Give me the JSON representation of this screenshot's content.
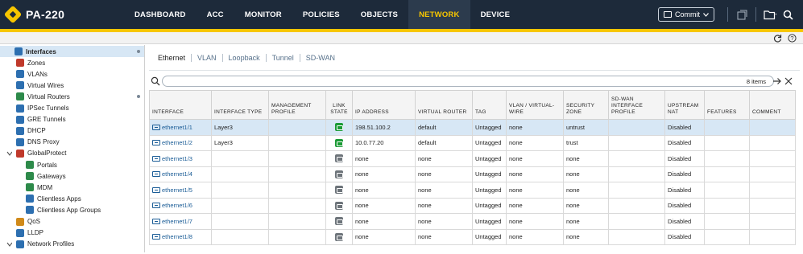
{
  "app": {
    "title": "PA-220"
  },
  "nav": [
    "DASHBOARD",
    "ACC",
    "MONITOR",
    "POLICIES",
    "OBJECTS",
    "NETWORK",
    "DEVICE"
  ],
  "active_nav": "NETWORK",
  "commit_label": "Commit",
  "sidebar": [
    {
      "label": "Interfaces",
      "icon": "interfaces-icon",
      "color": "#2d6fb0",
      "active": true,
      "dot": true
    },
    {
      "label": "Zones",
      "icon": "zones-icon",
      "color": "#c0392b"
    },
    {
      "label": "VLANs",
      "icon": "vlans-icon",
      "color": "#2d6fb0"
    },
    {
      "label": "Virtual Wires",
      "icon": "virtual-wires-icon",
      "color": "#2d6fb0"
    },
    {
      "label": "Virtual Routers",
      "icon": "virtual-routers-icon",
      "color": "#2d8a4a",
      "dot": true
    },
    {
      "label": "IPSec Tunnels",
      "icon": "ipsec-tunnels-icon",
      "color": "#2d6fb0"
    },
    {
      "label": "GRE Tunnels",
      "icon": "gre-tunnels-icon",
      "color": "#2d6fb0"
    },
    {
      "label": "DHCP",
      "icon": "dhcp-icon",
      "color": "#2d6fb0"
    },
    {
      "label": "DNS Proxy",
      "icon": "dns-proxy-icon",
      "color": "#2d6fb0"
    },
    {
      "label": "GlobalProtect",
      "icon": "globalprotect-icon",
      "color": "#c0392b"
    },
    {
      "label": "Portals",
      "icon": "portals-icon",
      "color": "#2d8a4a"
    },
    {
      "label": "Gateways",
      "icon": "gateways-icon",
      "color": "#2d8a4a"
    },
    {
      "label": "MDM",
      "icon": "mdm-icon",
      "color": "#2d8a4a"
    },
    {
      "label": "Clientless Apps",
      "icon": "clientless-apps-icon",
      "color": "#2d6fb0"
    },
    {
      "label": "Clientless App Groups",
      "icon": "clientless-app-groups-icon",
      "color": "#2d6fb0"
    },
    {
      "label": "QoS",
      "icon": "qos-icon",
      "color": "#d08a1a"
    },
    {
      "label": "LLDP",
      "icon": "lldp-icon",
      "color": "#2d6fb0"
    },
    {
      "label": "Network Profiles",
      "icon": "network-profiles-icon",
      "color": "#2d6fb0"
    }
  ],
  "tabs": [
    "Ethernet",
    "VLAN",
    "Loopback",
    "Tunnel",
    "SD-WAN"
  ],
  "active_tab": "Ethernet",
  "search": {
    "value": "",
    "count": "8 items"
  },
  "columns": [
    "INTERFACE",
    "INTERFACE TYPE",
    "MANAGEMENT PROFILE",
    "LINK STATE",
    "IP ADDRESS",
    "VIRTUAL ROUTER",
    "TAG",
    "VLAN / VIRTUAL-WIRE",
    "SECURITY ZONE",
    "SD-WAN INTERFACE PROFILE",
    "UPSTREAM NAT",
    "FEATURES",
    "COMMENT"
  ],
  "rows": [
    {
      "interface": "ethernet1/1",
      "type": "Layer3",
      "mgmt": "",
      "link": "up",
      "ip": "198.51.100.2",
      "vr": "default",
      "tag": "Untagged",
      "vlan": "none",
      "zone": "untrust",
      "sdwan": "",
      "nat": "Disabled",
      "features": "",
      "comment": "",
      "selected": true
    },
    {
      "interface": "ethernet1/2",
      "type": "Layer3",
      "mgmt": "",
      "link": "up",
      "ip": "10.0.77.20",
      "vr": "default",
      "tag": "Untagged",
      "vlan": "none",
      "zone": "trust",
      "sdwan": "",
      "nat": "Disabled",
      "features": "",
      "comment": ""
    },
    {
      "interface": "ethernet1/3",
      "type": "",
      "mgmt": "",
      "link": "down",
      "ip": "none",
      "vr": "none",
      "tag": "Untagged",
      "vlan": "none",
      "zone": "none",
      "sdwan": "",
      "nat": "Disabled",
      "features": "",
      "comment": ""
    },
    {
      "interface": "ethernet1/4",
      "type": "",
      "mgmt": "",
      "link": "down",
      "ip": "none",
      "vr": "none",
      "tag": "Untagged",
      "vlan": "none",
      "zone": "none",
      "sdwan": "",
      "nat": "Disabled",
      "features": "",
      "comment": ""
    },
    {
      "interface": "ethernet1/5",
      "type": "",
      "mgmt": "",
      "link": "down",
      "ip": "none",
      "vr": "none",
      "tag": "Untagged",
      "vlan": "none",
      "zone": "none",
      "sdwan": "",
      "nat": "Disabled",
      "features": "",
      "comment": ""
    },
    {
      "interface": "ethernet1/6",
      "type": "",
      "mgmt": "",
      "link": "down",
      "ip": "none",
      "vr": "none",
      "tag": "Untagged",
      "vlan": "none",
      "zone": "none",
      "sdwan": "",
      "nat": "Disabled",
      "features": "",
      "comment": ""
    },
    {
      "interface": "ethernet1/7",
      "type": "",
      "mgmt": "",
      "link": "down",
      "ip": "none",
      "vr": "none",
      "tag": "Untagged",
      "vlan": "none",
      "zone": "none",
      "sdwan": "",
      "nat": "Disabled",
      "features": "",
      "comment": ""
    },
    {
      "interface": "ethernet1/8",
      "type": "",
      "mgmt": "",
      "link": "down",
      "ip": "none",
      "vr": "none",
      "tag": "Untagged",
      "vlan": "none",
      "zone": "none",
      "sdwan": "",
      "nat": "Disabled",
      "features": "",
      "comment": ""
    }
  ],
  "colors": {
    "topbar": "#1d2a3a",
    "accent": "#f7c600",
    "selected_row": "#d7e7f5",
    "link_up": "#1a9a35",
    "link_down": "#6d747a",
    "link_text": "#1a5c96"
  }
}
